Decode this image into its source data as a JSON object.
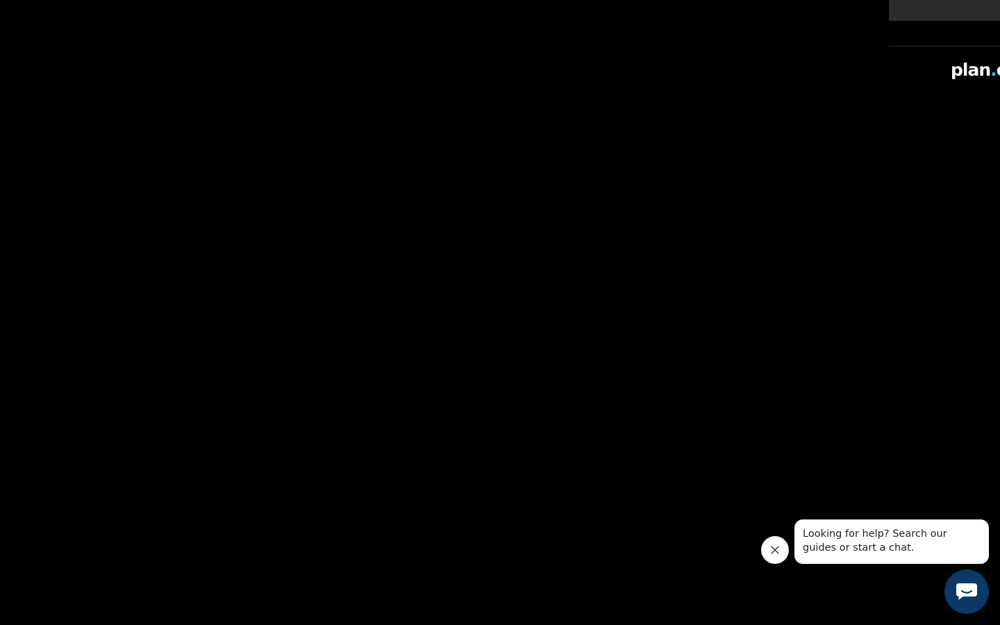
{
  "brand": {
    "logo_main": "plan",
    "logo_dot": ".",
    "logo_tail": "c",
    "accent_color": "#3fb5e6"
  },
  "help_widget": {
    "message": "Looking for help? Search our guides or start a chat.",
    "close_icon": "close-icon",
    "launcher_icon": "chat-bubble-icon",
    "launcher_color": "#0a3968"
  },
  "theme": {
    "background": "#000000",
    "panel_topbar": "#2b2b2b"
  }
}
